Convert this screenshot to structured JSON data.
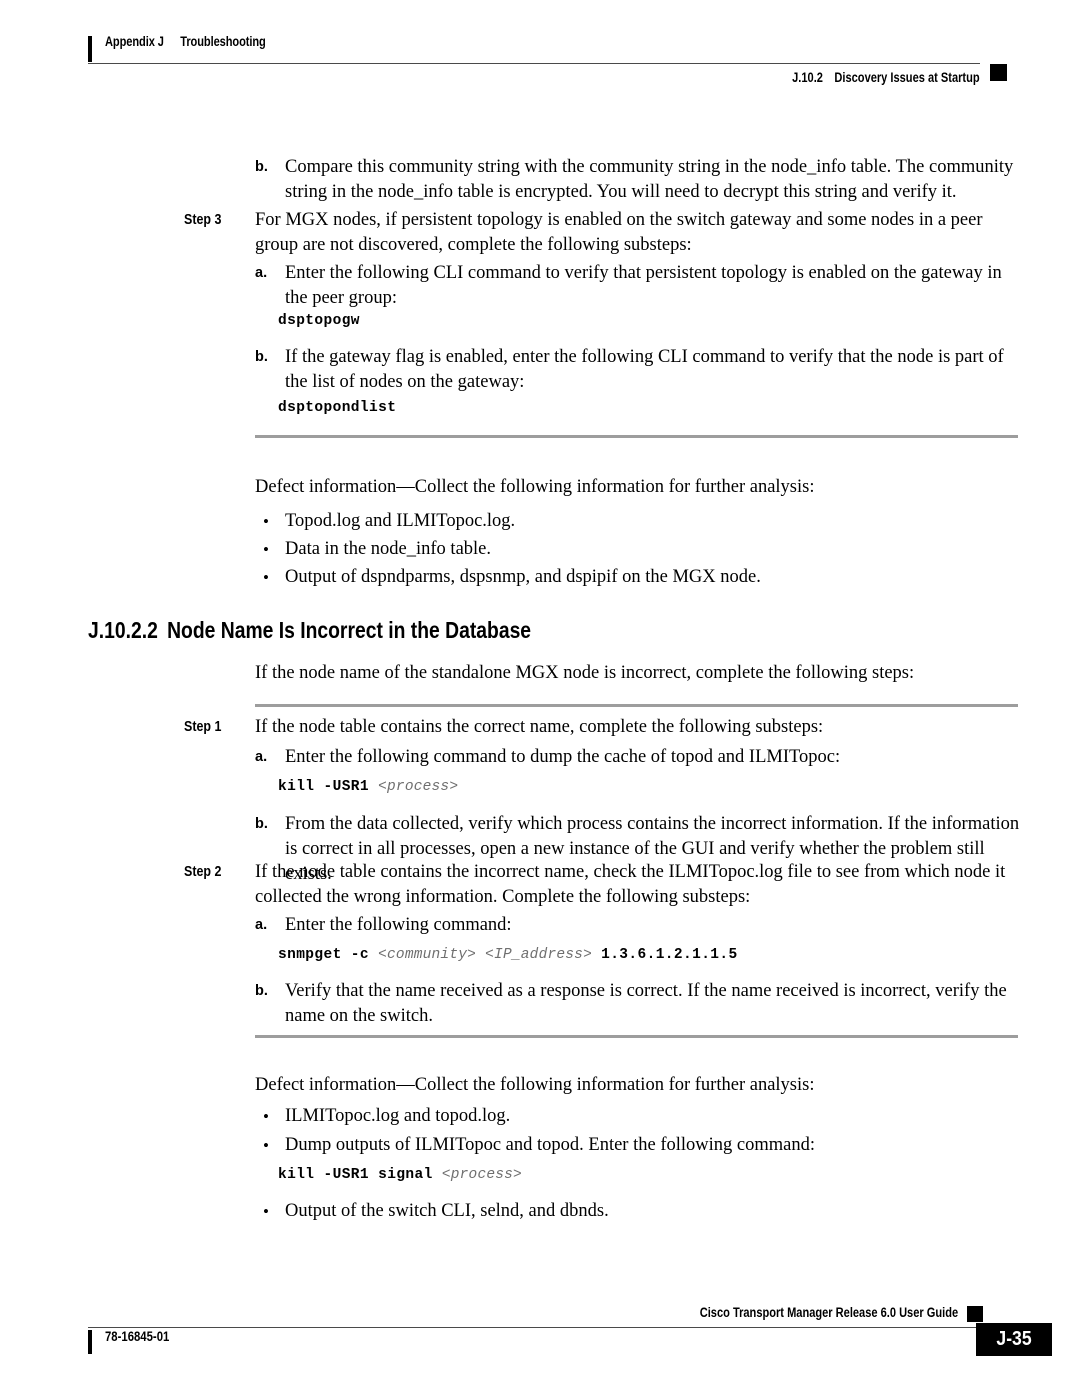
{
  "header": {
    "appendix": "Appendix J",
    "chapter": "Troubleshooting",
    "section_number": "J.10.2",
    "section_title": "Discovery Issues at Startup"
  },
  "footer": {
    "doc_number": "78-16845-01",
    "guide_title": "Cisco Transport Manager Release 6.0 User Guide",
    "page_number": "J-35"
  },
  "body": {
    "step3b_letter": "b.",
    "step3b_text": "Compare this community string with the community string in the node_info table. The community string in the node_info table is encrypted. You will need to decrypt this string and verify it.",
    "step3_label": "Step 3",
    "step3_text": "For MGX nodes, if persistent topology is enabled on the switch gateway and some nodes in a peer group are not discovered, complete the following substeps:",
    "step3a_letter": "a.",
    "step3a_text": "Enter the following CLI command to verify that persistent topology is enabled on the gateway in the peer group:",
    "cmd_dsptopogw": "dsptopogw",
    "step3b2_letter": "b.",
    "step3b2_text": "If the gateway flag is enabled, enter the following CLI command to verify that the node is part of the list of nodes on the gateway:",
    "cmd_dsptopondlist": "dsptopondlist",
    "defect1_intro": "Defect information—Collect the following information for further analysis:",
    "defect1_bullets": [
      "Topod.log and ILMITopoc.log.",
      "Data in the node_info table.",
      "Output of dspndparms, dspsnmp, and dspipif on the MGX node."
    ],
    "section_number": "J.10.2.2",
    "section_title": "Node Name Is Incorrect in the Database",
    "section_intro": "If the node name of the standalone MGX node is incorrect, complete the following steps:",
    "step1_label": "Step 1",
    "step1_text": "If the node table contains the correct name, complete the following substeps:",
    "step1a_letter": "a.",
    "step1a_text": "Enter the following command to dump the cache of topod and ILMITopoc:",
    "cmd_kill_bold": "kill -USR1",
    "cmd_kill_italic": "<process>",
    "step1b_letter": "b.",
    "step1b_text": "From the data collected, verify which process contains the incorrect information. If the information is correct in all processes, open a new instance of the GUI and verify whether the problem still exists.",
    "step2_label": "Step 2",
    "step2_text": "If the node table contains the incorrect name, check the ILMITopoc.log file to see from which node it collected the wrong information. Complete the following substeps:",
    "step2a_letter": "a.",
    "step2a_text": "Enter the following command:",
    "cmd_snmpget_bold1": "snmpget -c",
    "cmd_snmpget_italic1": "<community>",
    "cmd_snmpget_italic2": "<IP_address>",
    "cmd_snmpget_bold2": "1.3.6.1.2.1.1.5",
    "step2b_letter": "b.",
    "step2b_text": "Verify that the name received as a response is correct. If the name received is incorrect, verify the name on the switch.",
    "defect2_intro": "Defect information—Collect the following information for further analysis:",
    "defect2_bullet1": "ILMITopoc.log and topod.log.",
    "defect2_bullet2": "Dump outputs of ILMITopoc and topod. Enter the following command:",
    "cmd_kill_signal_bold": "kill -USR1 signal",
    "cmd_kill_signal_italic": "<process>",
    "defect2_bullet3": "Output of the switch CLI, selnd, and dbnds.",
    "bullet_glyph": "•"
  }
}
